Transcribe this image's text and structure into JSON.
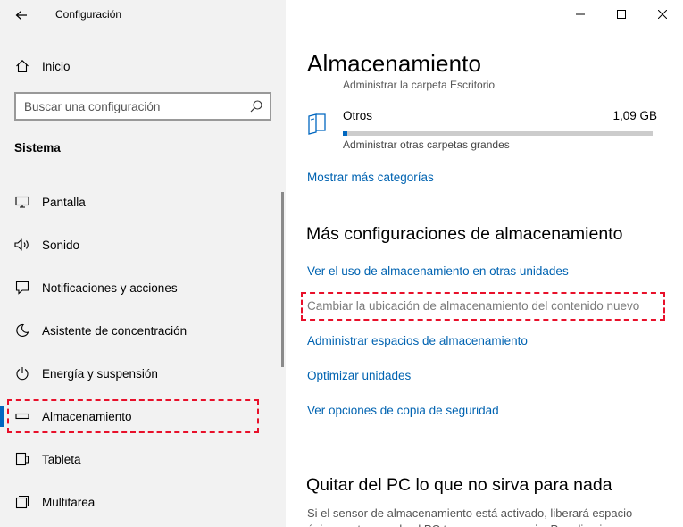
{
  "app": {
    "title": "Configuración",
    "back_icon": "back-arrow-icon"
  },
  "nav": {
    "home_label": "Inicio",
    "search": {
      "value": "",
      "placeholder": "Buscar una configuración"
    },
    "section_heading": "Sistema",
    "items": [
      {
        "label": "Pantalla",
        "icon": "display-icon",
        "selected": false
      },
      {
        "label": "Sonido",
        "icon": "speaker-icon",
        "selected": false
      },
      {
        "label": "Notificaciones y acciones",
        "icon": "notification-icon",
        "selected": false
      },
      {
        "label": "Asistente de concentración",
        "icon": "moon-icon",
        "selected": false
      },
      {
        "label": "Energía y suspensión",
        "icon": "power-icon",
        "selected": false
      },
      {
        "label": "Almacenamiento",
        "icon": "storage-drive-icon",
        "selected": true
      },
      {
        "label": "Tableta",
        "icon": "tablet-icon",
        "selected": false
      },
      {
        "label": "Multitarea",
        "icon": "multitasking-icon",
        "selected": false
      }
    ]
  },
  "content": {
    "page_title": "Almacenamiento",
    "cut_off_text": "Administrar la carpeta Escritorio",
    "storage_item": {
      "name": "Otros",
      "size": "1,09 GB",
      "subtitle": "Administrar otras carpetas grandes",
      "usage_fraction": 0.015
    },
    "more_categories_link": "Mostrar más categorías",
    "more_settings": {
      "title": "Más configuraciones de almacenamiento",
      "links": [
        {
          "label": "Ver el uso de almacenamiento en otras unidades",
          "disabled": false
        },
        {
          "label": "Cambiar la ubicación de almacenamiento del contenido nuevo",
          "disabled": true
        },
        {
          "label": "Administrar espacios de almacenamiento",
          "disabled": false
        },
        {
          "label": "Optimizar unidades",
          "disabled": false
        },
        {
          "label": "Ver opciones de copia de seguridad",
          "disabled": false
        }
      ]
    },
    "free_space": {
      "title": "Quitar del PC lo que no sirva para nada",
      "description": "Si el sensor de almacenamiento está activado, liberará espacio únicamente cuando el PC tenga poco espacio. Para limpiar"
    }
  },
  "caption_buttons": [
    "minimize-icon",
    "maximize-icon",
    "close-icon"
  ],
  "colors": {
    "accent": "#0067c0",
    "link": "#0063b1",
    "highlight": "#e8102a",
    "nav_background": "#f2f2f2"
  }
}
